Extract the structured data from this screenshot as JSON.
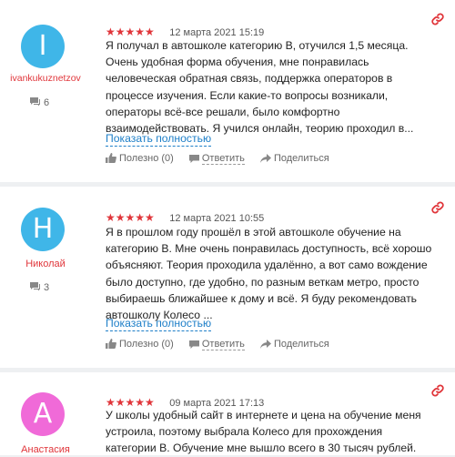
{
  "colors": {
    "accent": "#e0353a",
    "link": "#1e7fc8",
    "avatar_i": "#3fb6e8",
    "avatar_n": "#3fb6e8",
    "avatar_a": "#f06ad8"
  },
  "reviews": [
    {
      "avatar_letter": "I",
      "author": "ivankukuznetzov",
      "comments_count": "6",
      "stars": "★★★★★",
      "date": "12 марта 2021 15:19",
      "text": "Я получал в автошколе категорию В, отучился 1,5 месяца.\nОчень удобная форма обучения, мне понравилась\nчеловеческая обратная связь, поддержка операторов в\nпроцессе изучения. Если какие-то вопросы возникали,\nоператоры всё-все решали, было комфортно\nвзаимодействовать. Я учился онлайн, теорию проходил в...",
      "more": "Показать полностью",
      "useful": "Полезно (0)",
      "reply": "Ответить",
      "share": "Поделиться"
    },
    {
      "avatar_letter": "H",
      "author": "Николай",
      "comments_count": "3",
      "stars": "★★★★★",
      "date": "12 марта 2021 10:55",
      "text": "Я в прошлом году прошёл в этой автошколе обучение на\nкатегорию В. Мне очень понравилась доступность, всё хорошо\nобъясняют. Теория проходила удалённо, а вот само вождение\nбыло доступно, где удобно, по разным веткам метро, просто\nвыбираешь ближайшее к дому и всё. Я буду рекомендовать\nавтошколу Колесо ...",
      "more": "Показать полностью",
      "useful": "Полезно (0)",
      "reply": "Ответить",
      "share": "Поделиться"
    },
    {
      "avatar_letter": "A",
      "author": "Анастасия",
      "stars": "★★★★★",
      "date": "09 марта 2021 17:13",
      "text": "У школы удобный сайт в интернете и цена на обучение меня\nустроила, поэтому выбрала Колесо для прохождения\nкатегории В. Обучение мне вышло всего в 30 тысяч рублей."
    }
  ]
}
